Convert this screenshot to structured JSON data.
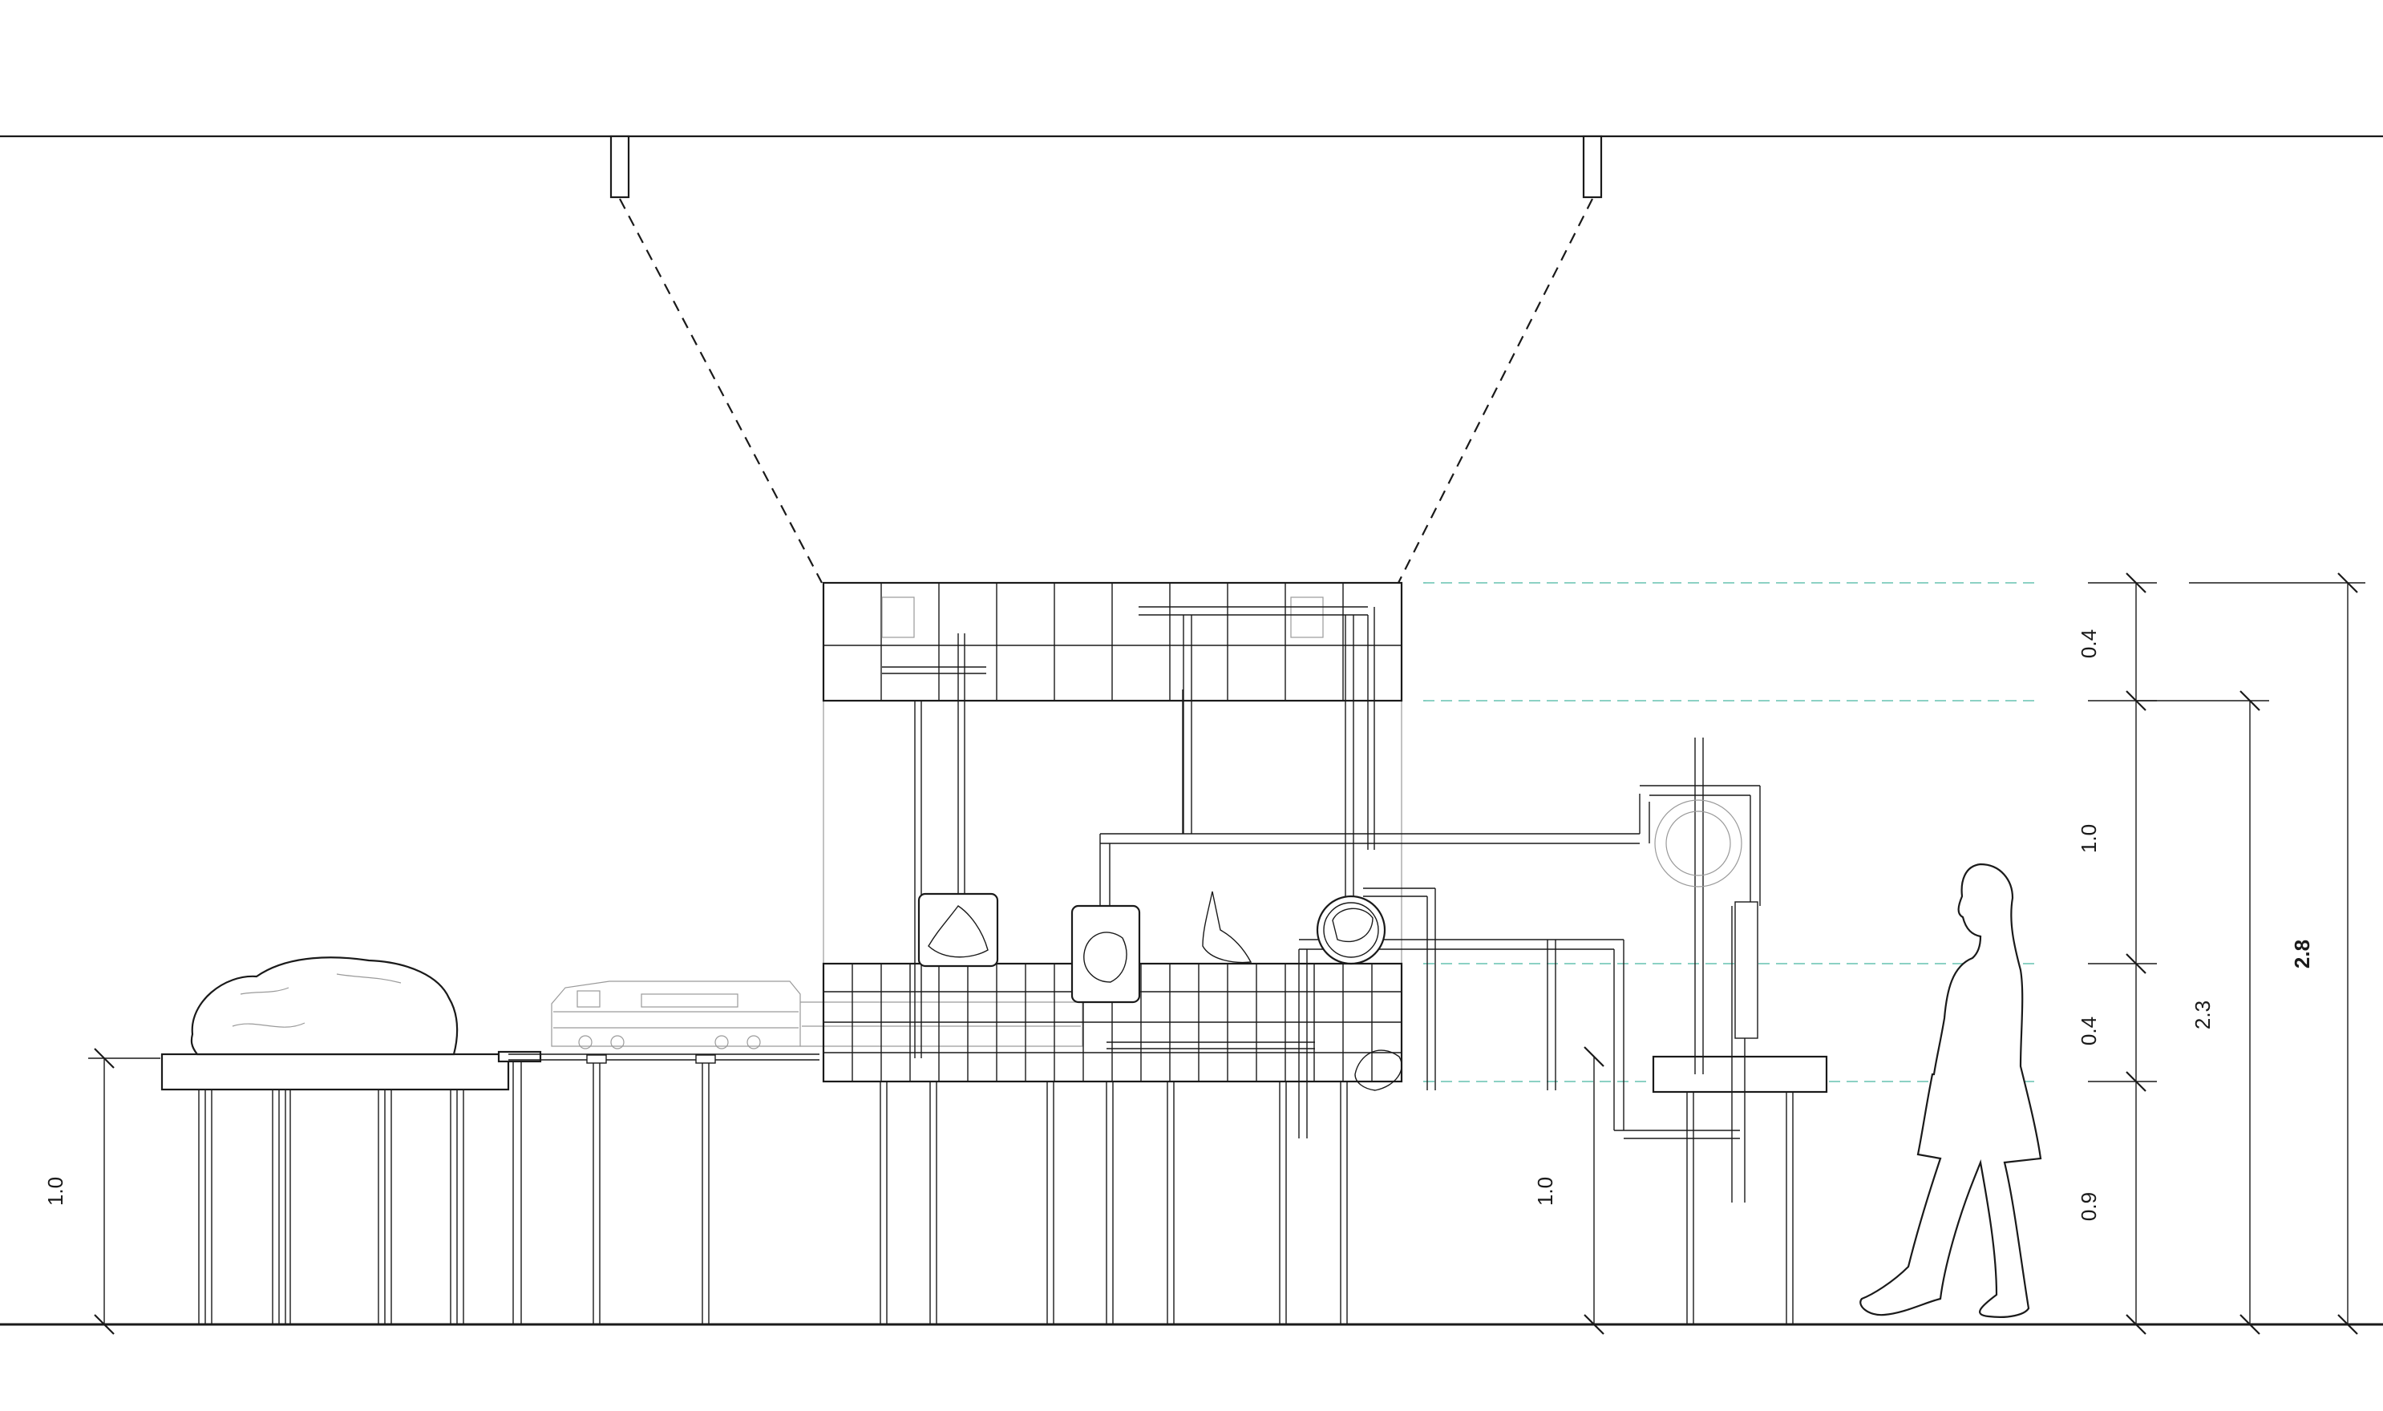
{
  "dimensions": {
    "left_table_height": "1.0",
    "right_table_height": "1.0",
    "seg_upper_grid": "0.4",
    "seg_middle_gap": "1.0",
    "seg_lower_grid": "0.4",
    "seg_base": "0.9",
    "total_to_top_of_gap": "2.3",
    "total_height": "2.8"
  },
  "colors": {
    "line": "#1a1a1a",
    "reference_line": "#66c2b0",
    "background": "#ffffff"
  },
  "icons": {
    "projector": "projector-icon",
    "boulder": "boulder-icon",
    "locomotive": "locomotive-icon",
    "person": "human-figure-icon"
  }
}
